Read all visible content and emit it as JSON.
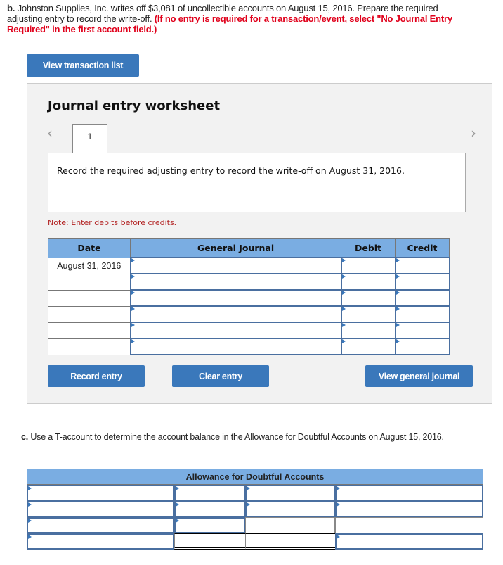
{
  "question_b": {
    "label": "b.",
    "text": "Johnston Supplies, Inc. writes off $3,081 of uncollectible accounts on August 15, 2016. Prepare the required adjusting entry to record the write-off.",
    "instruction": "(If no entry is required for a transaction/event, select \"No Journal Entry Required\" in the first account field.)"
  },
  "buttons": {
    "view_transaction_list": "View transaction list",
    "record_entry": "Record entry",
    "clear_entry": "Clear entry",
    "view_general_journal": "View general journal"
  },
  "worksheet": {
    "title": "Journal entry worksheet",
    "prev_arrow": "‹",
    "next_arrow": "›",
    "tabs": [
      {
        "label": "1"
      }
    ],
    "instruction": "Record the required adjusting entry to record the write-off on August 31, 2016.",
    "note": "Note: Enter debits before credits.",
    "table": {
      "headers": [
        "Date",
        "General Journal",
        "Debit",
        "Credit"
      ],
      "rows": [
        {
          "date": "August 31, 2016",
          "account": "",
          "debit": "",
          "credit": ""
        },
        {
          "date": "",
          "account": "",
          "debit": "",
          "credit": ""
        },
        {
          "date": "",
          "account": "",
          "debit": "",
          "credit": ""
        },
        {
          "date": "",
          "account": "",
          "debit": "",
          "credit": ""
        },
        {
          "date": "",
          "account": "",
          "debit": "",
          "credit": ""
        },
        {
          "date": "",
          "account": "",
          "debit": "",
          "credit": ""
        }
      ]
    }
  },
  "question_c": {
    "label": "c.",
    "text": "Use a T-account to determine the account balance in the Allowance for Doubtful Accounts on August 15, 2016."
  },
  "t_account": {
    "title": "Allowance for Doubtful Accounts"
  },
  "colors": {
    "button_blue": "#3a78bb",
    "header_blue": "#7aade2",
    "instruction_red": "#e0001b",
    "note_red": "#b22222"
  }
}
